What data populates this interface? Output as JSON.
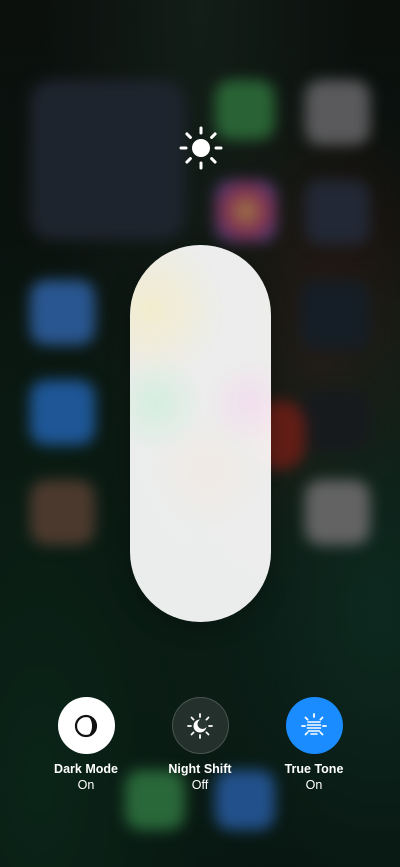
{
  "brightness": {
    "level": 1.0
  },
  "toggles": [
    {
      "label": "Dark Mode",
      "state": "On",
      "icon": "dark-mode-icon"
    },
    {
      "label": "Night Shift",
      "state": "Off",
      "icon": "night-shift-icon"
    },
    {
      "label": "True Tone",
      "state": "On",
      "icon": "true-tone-icon"
    }
  ],
  "colors": {
    "accent": "#1a8cff"
  }
}
